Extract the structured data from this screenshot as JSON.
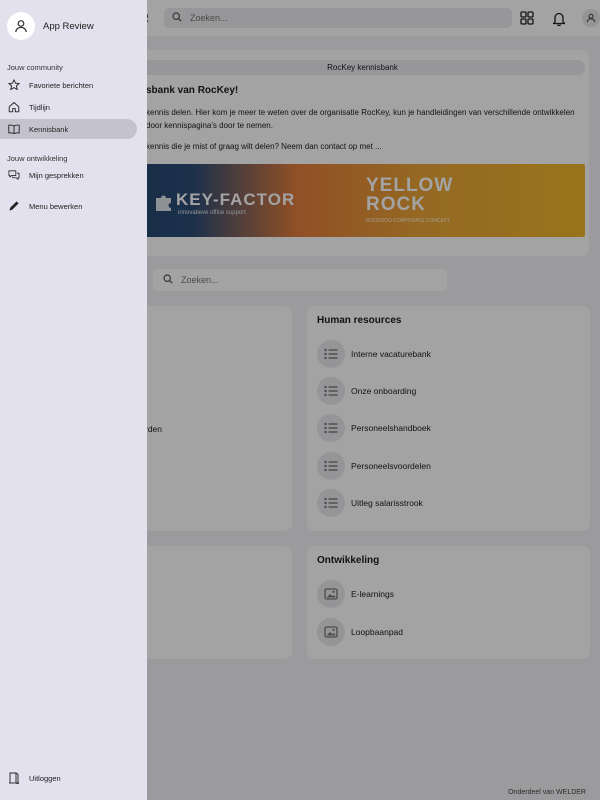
{
  "topbar": {
    "logo_fragment": "R",
    "search_placeholder": "Zoeken..."
  },
  "hero": {
    "pill_label": "RocKey kennisbank",
    "title": "sbank van RocKey!",
    "intro": "kennis delen. Hier kom je meer te weten over de organisatie RocKey, kun je handleidingen van verschillende ontwikkelen door kennispagina's door te nemen.",
    "question": "kennis die je mist of graag wilt delen? Neem dan contact op met ...",
    "banner": {
      "keyfactor_logo": "KEY-FACTOR",
      "keyfactor_tagline": "innovatieve office support",
      "yellowrock_logo": "YELLOW ROCK",
      "yellowrock_tagline": "ROCKDOG CORPORATE CONCEPT"
    }
  },
  "kb_search": {
    "placeholder": "Zoeken..."
  },
  "left_card_fragment": "rden",
  "cards": {
    "human_resources": {
      "title": "Human resources",
      "items": [
        "Interne vacaturebank",
        "Onze onboarding",
        "Personeelshandboek",
        "Personeelsvoordelen",
        "Uitleg salarisstrook"
      ]
    },
    "ontwikkeling": {
      "title": "Ontwikkeling",
      "items": [
        "E-learnings",
        "Loopbaanpad"
      ]
    }
  },
  "footer_note": "Onderdeel van WELDER",
  "drawer": {
    "title": "App Review",
    "community_label": "Jouw community",
    "community_items": [
      "Favoriete berichten",
      "Tijdlijn",
      "Kennisbank"
    ],
    "development_label": "Jouw ontwikkeling",
    "development_items": [
      "Mijn gesprekken"
    ],
    "edit_menu": "Menu bewerken",
    "logout": "Uitloggen"
  }
}
